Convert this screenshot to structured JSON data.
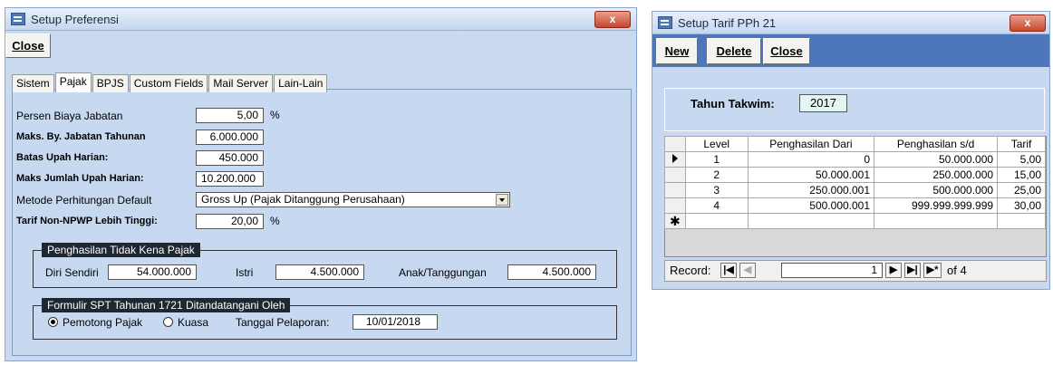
{
  "left_window": {
    "title": "Setup Preferensi",
    "close_x": "x",
    "toolbar": {
      "close_label": "Close"
    },
    "tabs": [
      "Sistem",
      "Pajak",
      "BPJS",
      "Custom Fields",
      "Mail Server",
      "Lain-Lain"
    ],
    "active_tab": "Pajak",
    "fields": {
      "persen_biaya_jabatan": {
        "label": "Persen Biaya Jabatan",
        "value": "5,00",
        "unit": "%"
      },
      "maks_by_jabatan": {
        "label": "Maks. By. Jabatan Tahunan",
        "value": "6.000.000"
      },
      "batas_upah_harian": {
        "label": "Batas Upah Harian:",
        "value": "450.000"
      },
      "maks_jumlah_upah": {
        "label": "Maks Jumlah Upah Harian:",
        "value": "10.200.000"
      },
      "metode": {
        "label": "Metode Perhitungan Default",
        "value": "Gross Up (Pajak Ditanggung Perusahaan)"
      },
      "tarif_non_npwp": {
        "label": "Tarif Non-NPWP Lebih Tinggi:",
        "value": "20,00",
        "unit": "%"
      }
    },
    "ptkp": {
      "title": "Penghasilan Tidak Kena Pajak",
      "diri_label": "Diri Sendiri",
      "diri_value": "54.000.000",
      "istri_label": "Istri",
      "istri_value": "4.500.000",
      "anak_label": "Anak/Tanggungan",
      "anak_value": "4.500.000"
    },
    "spt": {
      "title": "Formulir SPT Tahunan 1721 Ditandatangani Oleh",
      "radio1": "Pemotong Pajak",
      "radio2": "Kuasa",
      "selected": "Pemotong Pajak",
      "tanggal_label": "Tanggal Pelaporan:",
      "tanggal_value": "10/01/2018"
    }
  },
  "right_window": {
    "title": "Setup Tarif PPh 21",
    "close_x": "x",
    "toolbar": {
      "new_label": "New",
      "delete_label": "Delete",
      "close_label": "Close"
    },
    "tahun_label": "Tahun Takwim:",
    "tahun_value": "2017",
    "columns": [
      "Level",
      "Penghasilan Dari",
      "Penghasilan s/d",
      "Tarif"
    ],
    "rows": [
      [
        "1",
        "0",
        "50.000.000",
        "5,00"
      ],
      [
        "2",
        "50.000.001",
        "250.000.000",
        "15,00"
      ],
      [
        "3",
        "250.000.001",
        "500.000.000",
        "25,00"
      ],
      [
        "4",
        "500.000.001",
        "999.999.999.999",
        "30,00"
      ]
    ],
    "nav": {
      "record_label": "Record:",
      "current": "1",
      "of_label": "of 4"
    }
  },
  "colors": {
    "window_bg": "#c9d9f0",
    "toolbar_bg": "#4d76bb",
    "close_button": "#c8452c",
    "group_title_bg": "#1f2733"
  },
  "icons": [
    "window-app-icon",
    "close-x-icon",
    "dropdown-arrow-icon",
    "record-selector-arrow-icon",
    "new-record-star-icon",
    "nav-first-icon",
    "nav-prev-icon",
    "nav-next-icon",
    "nav-last-icon",
    "nav-new-icon"
  ]
}
